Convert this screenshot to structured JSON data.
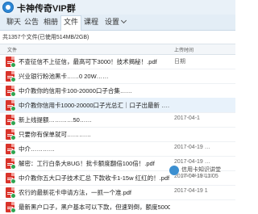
{
  "window": {
    "title": "卡神传奇VIP群"
  },
  "tabs": [
    {
      "label": "聊天"
    },
    {
      "label": "公告"
    },
    {
      "label": "相册"
    },
    {
      "label": "文件"
    },
    {
      "label": "课程"
    },
    {
      "label": "设置"
    }
  ],
  "active_tab": "文件",
  "summary": "共1357个文件(已使用514MB/2GB)",
  "table": {
    "columns": [
      "文件",
      "上传时间"
    ],
    "rows": [
      {
        "name": "不查征信不上征信，最高可下3000！技术揭秘！.pdf",
        "date": "日期"
      },
      {
        "name": "兴业银行粉池黑卡……0 20W……",
        "date": ""
      },
      {
        "name": "中介教你的信用卡100-20000口子合集……",
        "date": ""
      },
      {
        "name": "中介教你信用卡1000-20000口子光总汇｜口子出最新 ……",
        "date": ""
      },
      {
        "name": "新上线提额…………50……",
        "date": "2017-04-1"
      },
      {
        "name": "只要你有保单就可…………",
        "date": ""
      },
      {
        "name": "中介…………",
        "date": "2017-04-19 …"
      },
      {
        "name": "解密：工行白条大BUG！批卡额度翻倍100倍！.pdf",
        "date": "2017-04-19 …"
      },
      {
        "name": "中介教你五大口子技术汇总  下款收卡1-15w 红红的！.pdf",
        "date": "2017-04-19 11:05"
      },
      {
        "name": "农行的最新花卡申请方法，一抓一个准.pdf",
        "date": "2017-04-19 1"
      },
      {
        "name": "最新黑户口子，黑户基本可以下款，但速到倒，额度5000！.pdf",
        "date": ""
      }
    ]
  },
  "watermark": {
    "text": "信用卡知识讲堂",
    "sub": "2017-04-19 11:32"
  }
}
